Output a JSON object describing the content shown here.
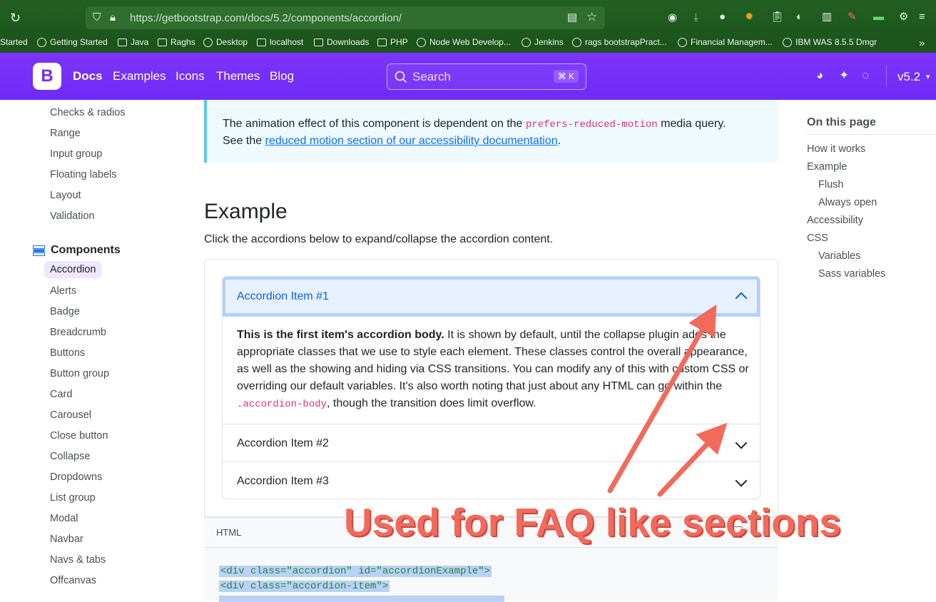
{
  "browser": {
    "url": "https://getbootstrap.com/docs/5.2/components/accordion/",
    "bookmarks": [
      "Started",
      "Getting Started",
      "Java",
      "Raghs",
      "Desktop",
      "localhost",
      "Downloads",
      "PHP",
      "Node Web Develop...",
      "Jenkins",
      "rags bootstrapPract...",
      "Financial Managem...",
      "IBM WAS 8.5.5 Dmgr"
    ]
  },
  "navbar": {
    "logo": "B",
    "links": [
      "Docs",
      "Examples",
      "Icons",
      "Themes",
      "Blog"
    ],
    "search_label": "Search",
    "search_kbd": "⌘ K",
    "version": "v5.2"
  },
  "sidebar": {
    "items_top": [
      "Checks & radios",
      "Range",
      "Input group",
      "Floating labels",
      "Layout",
      "Validation"
    ],
    "components_heading": "Components",
    "components": [
      "Accordion",
      "Alerts",
      "Badge",
      "Breadcrumb",
      "Buttons",
      "Button group",
      "Card",
      "Carousel",
      "Close button",
      "Collapse",
      "Dropdowns",
      "List group",
      "Modal",
      "Navbar",
      "Navs & tabs",
      "Offcanvas"
    ]
  },
  "callout": {
    "line1_pre": "The animation effect of this component is dependent on the ",
    "line1_code": "prefers-reduced-motion",
    "line1_post": " media query.",
    "line2_pre": "See the ",
    "line2_link": "reduced motion section of our accessibility documentation",
    "line2_post": "."
  },
  "example": {
    "title": "Example",
    "description": "Click the accordions below to expand/collapse the accordion content.",
    "items": [
      "Accordion Item #1",
      "Accordion Item #2",
      "Accordion Item #3"
    ],
    "body_bold": "This is the first item's accordion body.",
    "body_text": " It is shown by default, until the collapse plugin adds the appropriate classes that we use to style each element. These classes control the overall appearance, as well as the showing and hiding via CSS transitions. You can modify any of this with custom CSS or overriding our default variables. It's also worth noting that just about any HTML can go within the ",
    "body_code": ".accordion-body",
    "body_end": ", though the transition does limit overflow."
  },
  "code": {
    "lang": "HTML",
    "line1": "<div class=\"accordion\" id=\"accordionExample\">",
    "line2": "  <div class=\"accordion-item\">"
  },
  "toc": {
    "title": "On this page",
    "items": [
      "How it works",
      "Example",
      "Flush",
      "Always open",
      "Accessibility",
      "CSS",
      "Variables",
      "Sass variables"
    ]
  },
  "annotation": {
    "text": "Used for FAQ like sections",
    "color": "#f26a5c"
  }
}
